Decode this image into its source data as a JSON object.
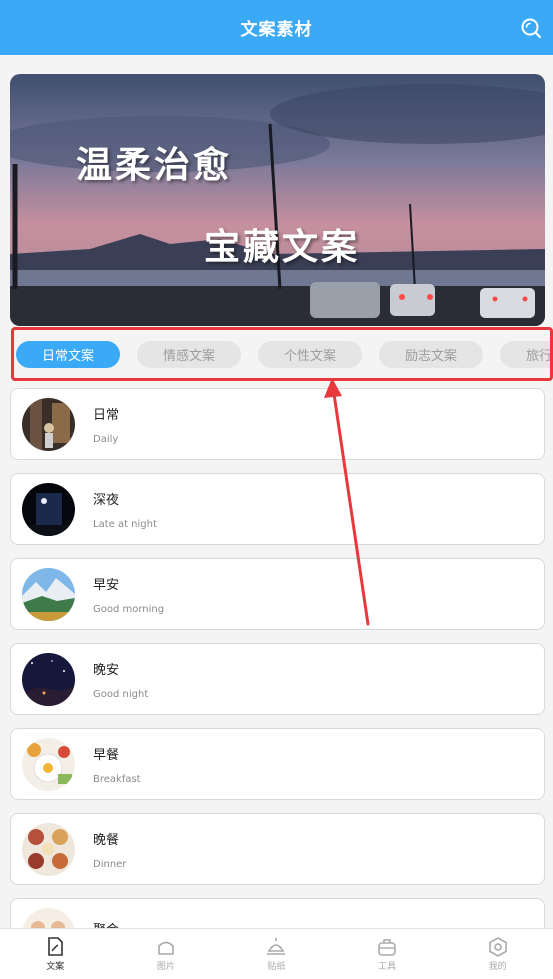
{
  "header": {
    "title": "文案素材",
    "search_icon": "search-icon"
  },
  "banner": {
    "line1": "温柔治愈",
    "line2": "宝藏文案"
  },
  "tabs": [
    {
      "label": "日常文案",
      "active": true
    },
    {
      "label": "情感文案",
      "active": false
    },
    {
      "label": "个性文案",
      "active": false
    },
    {
      "label": "励志文案",
      "active": false
    },
    {
      "label": "旅行文案",
      "active": false
    }
  ],
  "categories": [
    {
      "name": "日常",
      "en": "Daily"
    },
    {
      "name": "深夜",
      "en": "Late at night"
    },
    {
      "name": "早安",
      "en": "Good morning"
    },
    {
      "name": "晚安",
      "en": "Good night"
    },
    {
      "name": "早餐",
      "en": "Breakfast"
    },
    {
      "name": "晚餐",
      "en": "Dinner"
    },
    {
      "name": "聚会",
      "en": ""
    }
  ],
  "nav": [
    {
      "label": "文案",
      "icon": "document-icon",
      "active": true
    },
    {
      "label": "图片",
      "icon": "image-icon",
      "active": false
    },
    {
      "label": "贴纸",
      "icon": "sticker-icon",
      "active": false
    },
    {
      "label": "工具",
      "icon": "toolbox-icon",
      "active": false
    },
    {
      "label": "我的",
      "icon": "profile-icon",
      "active": false
    }
  ],
  "colors": {
    "primary": "#3aa9f6",
    "highlight_border": "#e8383d",
    "annotation_arrow": "#e8383d"
  }
}
